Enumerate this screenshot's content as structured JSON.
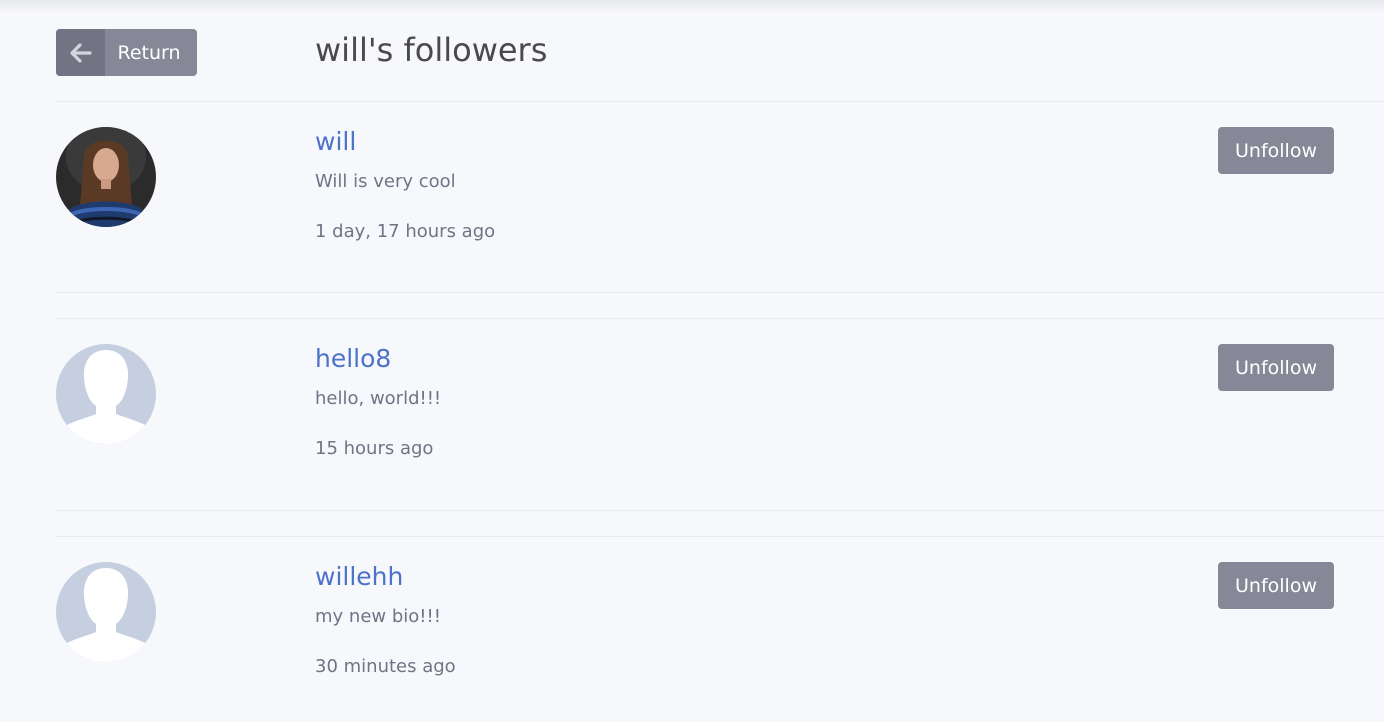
{
  "header": {
    "return_label": "Return",
    "title": "will's followers"
  },
  "followers": [
    {
      "username": "will",
      "bio": "Will is very cool",
      "time": "1 day, 17 hours ago",
      "action_label": "Unfollow",
      "avatar": "photo-avatar"
    },
    {
      "username": "hello8",
      "bio": "hello, world!!!",
      "time": "15 hours ago",
      "action_label": "Unfollow",
      "avatar": "default-avatar"
    },
    {
      "username": "willehh",
      "bio": "my new bio!!!",
      "time": "30 minutes ago",
      "action_label": "Unfollow",
      "avatar": "default-avatar"
    }
  ],
  "icons": {
    "return": "arrow-left-icon"
  },
  "colors": {
    "button": "#868797",
    "button_icon_bg": "#727383",
    "link": "#4d72c9",
    "muted_text": "#727383",
    "default_avatar_bg": "#c5cfe0",
    "background": "#f7f8fc"
  }
}
